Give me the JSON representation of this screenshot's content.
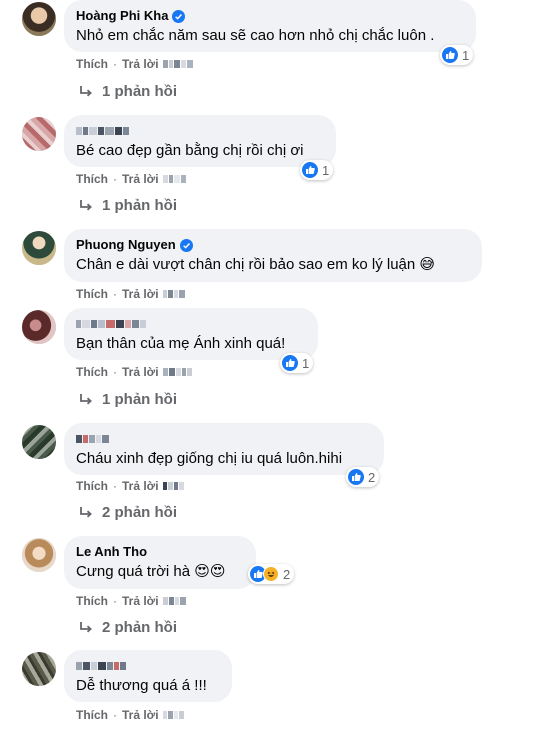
{
  "labels": {
    "like": "Thích",
    "reply": "Trả lời",
    "separator": "·"
  },
  "colors": {
    "accent": "#1877f2",
    "secondary_text": "#65676b",
    "bubble": "#f0f2f5"
  },
  "comments": [
    {
      "author": "Hoàng Phi Kha",
      "verified": true,
      "text": "Nhỏ em chắc năm sau sẽ cao hơn nhỏ chị chắc luôn .",
      "reaction_count": "1",
      "reactions": [
        "like"
      ],
      "replies": "1 phản hồi"
    },
    {
      "author": "",
      "verified": false,
      "text": "Bé cao đẹp gần bằng chị rồi chị ơi",
      "reaction_count": "1",
      "reactions": [
        "like"
      ],
      "replies": "1 phản hồi"
    },
    {
      "author": "Phuong Nguyen",
      "verified": true,
      "text": "Chân e dài vượt chân chị rồi bảo sao em ko lý luận 😅",
      "reaction_count": "",
      "reactions": [],
      "replies": ""
    },
    {
      "author": "",
      "verified": false,
      "text": "Bạn thân của mẹ Ánh xinh quá!",
      "reaction_count": "1",
      "reactions": [
        "like"
      ],
      "replies": "1 phản hồi"
    },
    {
      "author": "",
      "verified": false,
      "text": "Cháu xinh đẹp giống chị iu quá luôn.hihi",
      "reaction_count": "2",
      "reactions": [
        "like"
      ],
      "replies": "2 phản hồi"
    },
    {
      "author": "Le Anh Tho",
      "verified": false,
      "text": "Cưng quá trời hà 😍😍",
      "reaction_count": "2",
      "reactions": [
        "like",
        "haha"
      ],
      "replies": "2 phản hồi"
    },
    {
      "author": "",
      "verified": false,
      "text": "Dễ thương quá á !!!",
      "reaction_count": "",
      "reactions": [],
      "replies": ""
    }
  ]
}
